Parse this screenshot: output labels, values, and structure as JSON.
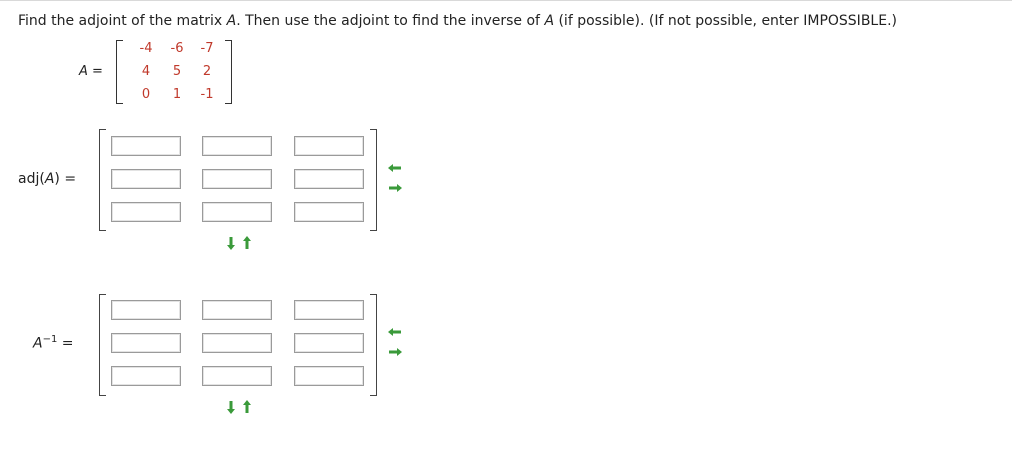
{
  "question": {
    "part1": "Find the adjoint of the matrix ",
    "var": "A",
    "part2": ". Then use the adjoint to find the inverse of ",
    "var2": "A",
    "part3": " (if possible). (If not possible, enter IMPOSSIBLE.)"
  },
  "matrix_a": {
    "label_var": "A",
    "label_eq": " =",
    "rows": [
      [
        "-4",
        "-6",
        "-7"
      ],
      [
        "4",
        "5",
        "2"
      ],
      [
        "0",
        "1",
        "-1"
      ]
    ]
  },
  "adj": {
    "label_pre": "adj(",
    "label_var": "A",
    "label_post": ") ="
  },
  "inv": {
    "label_var": "A",
    "label_sup": "−1",
    "label_eq": " ="
  },
  "colors": {
    "given_entries": "#c0392b",
    "arrow_green": "#3a9a3a"
  },
  "icons": {
    "row_arrows": "left-right-arrows-icon",
    "col_arrows": "down-up-arrows-icon"
  }
}
